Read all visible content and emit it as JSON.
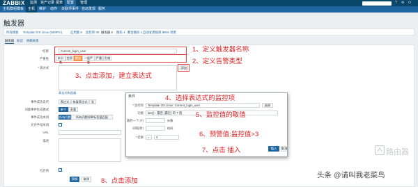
{
  "header": {
    "logo": "ZABBIX",
    "nav": [
      "监测",
      "资产记录",
      "报表",
      "配置",
      "管理"
    ],
    "subnav": [
      "主机群组",
      "模板",
      "主机",
      "维护",
      "动作",
      "关联项事件",
      "自动发现",
      "服务"
    ],
    "topicons": [
      "?",
      "⚙",
      "⏻"
    ]
  },
  "page": {
    "title": "触发器",
    "breadcrumb": [
      "所有模板",
      "Template OS Linux (NIMPro)",
      "应用集 9",
      "监控项 38",
      "触发器 9",
      "图形 4",
      "聚合图形 1",
      "自动发现规则 2",
      "Web 场景"
    ],
    "tabs": [
      "触发器",
      "标记",
      "依赖关系"
    ]
  },
  "form": {
    "name_label": "*名称",
    "name_value": "Current_login_user",
    "severity_label": "严重性",
    "severities": [
      "未分类",
      "信息",
      "警告",
      "一般严重",
      "严重",
      "灾难"
    ],
    "severity_selected": "警告",
    "expression_label": "* 表达式",
    "add_button": "添加",
    "expression_constructor": "表达式构造器",
    "ok_event_label": "事件成功迭代",
    "ok_event_options": [
      "表达式",
      "恢复表达式",
      "无"
    ],
    "problem_mode_label": "问题事件生成模式",
    "problem_mode_options": [
      "单个",
      "多重"
    ],
    "ok_close_label": "事件成功关闭",
    "ok_close_options": [
      "所有问题",
      "所有问题如果标签值匹配"
    ],
    "manual_close_label": "允许手动关闭",
    "url_label": "URL",
    "desc_label": "描述",
    "enabled_label": "已启用",
    "submit_add": "添加",
    "cancel": "取消"
  },
  "dialog": {
    "title": "条件",
    "item_label": "* 监控项",
    "item_value": "Template OS Linux: Current_login_user",
    "select_button": "选择",
    "function_label": "功能",
    "function_value": "last() - 最后 (最近) 的 T 值",
    "last_label": "最后一个 (T)",
    "last_unit": "计数",
    "shift_label": "间隔(秒)",
    "shift_unit": "时间",
    "result_label": "* 结果",
    "result_op": "=",
    "result_value": "3",
    "insert_button": "插入",
    "cancel_button": "取消"
  },
  "annotations": [
    "1、定义触发器名称",
    "2、定义告警类型",
    "3、点击添加，建立表达式",
    "4、选择表达式的监控项",
    "5、监控值的取值",
    "6、预警值:监控值>3",
    "7、点击 插入",
    "8、点击添加"
  ],
  "watermark": {
    "logo_text": "路由器",
    "credit": "头条 @请叫我老菜鸟"
  },
  "colors": {
    "header_dark": "#0a466a",
    "header_blue": "#1f65a0",
    "annotation_red": "#e02020",
    "severity_warning": "#ffa059"
  }
}
